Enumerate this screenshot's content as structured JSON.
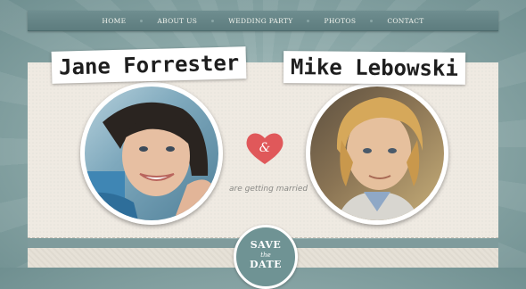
{
  "nav": {
    "items": [
      {
        "label": "HOME"
      },
      {
        "label": "ABOUT US"
      },
      {
        "label": "WEDDING PARTY"
      },
      {
        "label": "PHOTOS"
      },
      {
        "label": "CONTACT"
      }
    ]
  },
  "couple": {
    "left_name": "Jane Forrester",
    "right_name": "Mike Lebowski",
    "ampersand": "&",
    "tagline": "are getting married"
  },
  "badge": {
    "line1": "SAVE",
    "line2": "the",
    "line3": "DATE"
  },
  "colors": {
    "heart": "#e0585a",
    "nav_bg": "#6a898b",
    "card_bg": "#efeae2",
    "badge_bg": "#6f9394"
  },
  "icons": {
    "heart": "heart-icon",
    "left_photo": "woman-portrait",
    "right_photo": "man-portrait"
  }
}
